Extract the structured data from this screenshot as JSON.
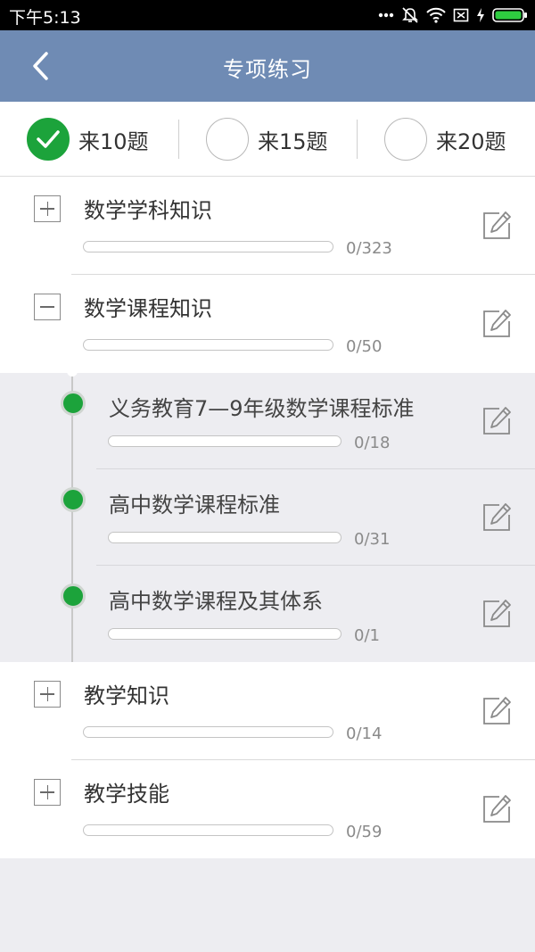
{
  "status_bar": {
    "time": "下午5:13",
    "icons": [
      "more-dots-icon",
      "mute-icon",
      "wifi-icon",
      "sim-icon",
      "charging-icon",
      "battery-icon"
    ]
  },
  "header": {
    "title": "专项练习",
    "back_icon": "chevron-left-icon"
  },
  "question_count": {
    "options": [
      {
        "label": "来10题",
        "selected": true
      },
      {
        "label": "来15题",
        "selected": false
      },
      {
        "label": "来20题",
        "selected": false
      }
    ]
  },
  "categories": [
    {
      "name": "数学学科知识",
      "progress_text": "0/323",
      "progress": 0,
      "expanded": false
    },
    {
      "name": "数学课程知识",
      "progress_text": "0/50",
      "progress": 0,
      "expanded": true,
      "children": [
        {
          "name": "义务教育7—9年级数学课程标准",
          "progress_text": "0/18",
          "progress": 0
        },
        {
          "name": "高中数学课程标准",
          "progress_text": "0/31",
          "progress": 0
        },
        {
          "name": "高中数学课程及其体系",
          "progress_text": "0/1",
          "progress": 0
        }
      ]
    },
    {
      "name": "教学知识",
      "progress_text": "0/14",
      "progress": 0,
      "expanded": false
    },
    {
      "name": "教学技能",
      "progress_text": "0/59",
      "progress": 0,
      "expanded": false
    }
  ],
  "colors": {
    "header": "#6f8bb4",
    "accent_green": "#1ca33b",
    "background": "#ededf1"
  }
}
